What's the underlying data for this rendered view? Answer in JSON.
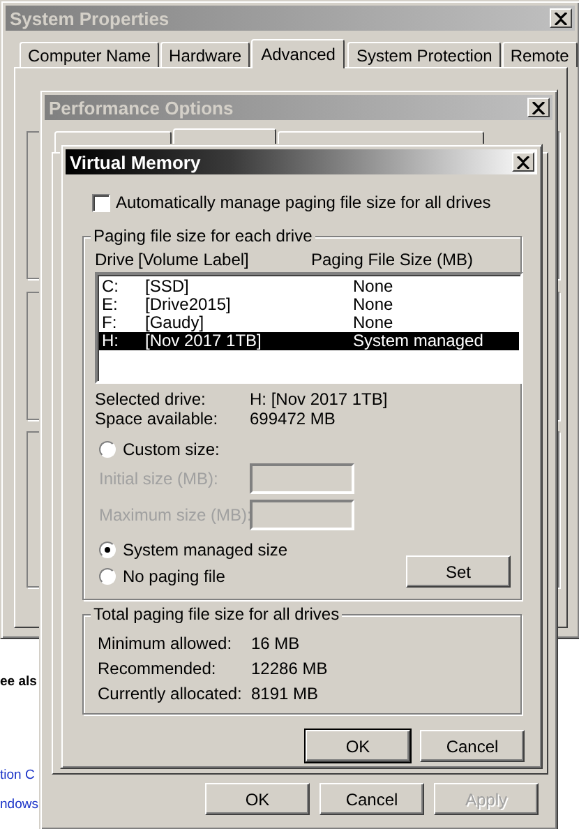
{
  "background_page": {
    "heading": "ee als",
    "links": [
      "tion C",
      "ndows"
    ]
  },
  "system_properties": {
    "title": "System Properties",
    "active": false,
    "tabs": [
      {
        "label": "Computer Name",
        "selected": false
      },
      {
        "label": "Hardware",
        "selected": false
      },
      {
        "label": "Advanced",
        "selected": true
      },
      {
        "label": "System Protection",
        "selected": false
      },
      {
        "label": "Remote",
        "selected": false
      }
    ]
  },
  "performance_options": {
    "title": "Performance Options",
    "active": false,
    "buttons": [
      {
        "label": "OK",
        "disabled": false
      },
      {
        "label": "Cancel",
        "disabled": false
      },
      {
        "label": "Apply",
        "disabled": true
      }
    ]
  },
  "virtual_memory": {
    "title": "Virtual Memory",
    "active": true,
    "auto_manage": {
      "label": "Automatically manage paging file size for all drives",
      "checked": false
    },
    "drives_group": {
      "title": "Paging file size for each drive",
      "columns": [
        "Drive",
        "[Volume Label]",
        "Paging File Size (MB)"
      ],
      "rows": [
        {
          "drive": "C:",
          "volume": "[SSD]",
          "size": "None",
          "selected": false
        },
        {
          "drive": "E:",
          "volume": "[Drive2015]",
          "size": "None",
          "selected": false
        },
        {
          "drive": "F:",
          "volume": "[Gaudy]",
          "size": "None",
          "selected": false
        },
        {
          "drive": "H:",
          "volume": "[Nov 2017 1TB]",
          "size": "System managed",
          "selected": true
        }
      ],
      "info": [
        {
          "label": "Selected drive:",
          "value": "H:  [Nov 2017 1TB]"
        },
        {
          "label": "Space available:",
          "value": "699472 MB"
        }
      ],
      "options": [
        {
          "label": "Custom size:",
          "selected": false
        },
        {
          "label": "System managed size",
          "selected": true
        },
        {
          "label": "No paging file",
          "selected": false
        }
      ],
      "fields": [
        {
          "label": "Initial size (MB):",
          "disabled": true
        },
        {
          "label": "Maximum size (MB):",
          "disabled": true
        }
      ],
      "set_button": "Set"
    },
    "totals": {
      "title": "Total paging file size for all drives",
      "rows": [
        {
          "label": "Minimum allowed:",
          "value": "16 MB"
        },
        {
          "label": "Recommended:",
          "value": "12286 MB"
        },
        {
          "label": "Currently allocated:",
          "value": "8191 MB"
        }
      ]
    },
    "buttons": [
      {
        "label": "OK",
        "default": true
      },
      {
        "label": "Cancel",
        "default": false
      }
    ]
  }
}
